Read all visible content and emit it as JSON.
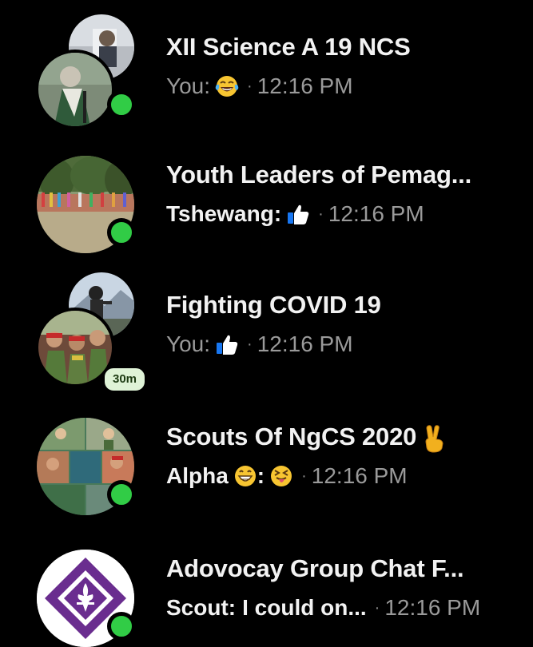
{
  "chats": [
    {
      "title": "XII Science A 19 NCS",
      "sender": "You:",
      "message_icon": "face-with-tears-of-joy-emoji",
      "separator": "·",
      "time": "12:16 PM",
      "unread": false,
      "online": true,
      "avatar_icons": [
        "group-photo-avatar-back",
        "group-photo-avatar-front"
      ]
    },
    {
      "title": "Youth Leaders of Pemag...",
      "sender": "Tshewang:",
      "message_icon": "thumbs-up-icon",
      "separator": "·",
      "time": "12:16 PM",
      "unread": true,
      "online": true,
      "avatar_icons": [
        "parade-ground-photo-avatar"
      ]
    },
    {
      "title": "Fighting COVID 19",
      "sender": "You:",
      "message_icon": "thumbs-up-icon",
      "separator": "·",
      "time": "12:16 PM",
      "unread": false,
      "online": false,
      "last_active": "30m",
      "avatar_icons": [
        "mountain-photo-avatar-back",
        "scouts-photo-avatar-front"
      ]
    },
    {
      "title": "Scouts Of NgCS 2020",
      "title_icon": "victory-hand-emoji",
      "sender": "Alpha",
      "sender_icon": "grinning-face-emoji",
      "colon": ":",
      "message_icon": "squinting-tongue-face-emoji",
      "separator": "·",
      "time": "12:16 PM",
      "unread": true,
      "online": true,
      "avatar_icons": [
        "scouts-collage-avatar"
      ]
    },
    {
      "title": "Adovocay Group Chat F...",
      "sender": "Scout:",
      "message": "I could on...",
      "separator": "·",
      "time": "12:16 PM",
      "unread": true,
      "online": true,
      "avatar_icons": [
        "scout-emblem-avatar"
      ]
    }
  ],
  "colors": {
    "background": "#000000",
    "online": "#31cc46",
    "title": "#f2f2f2",
    "muted": "#9a9a9a",
    "badge_bg": "#dff3d7"
  }
}
